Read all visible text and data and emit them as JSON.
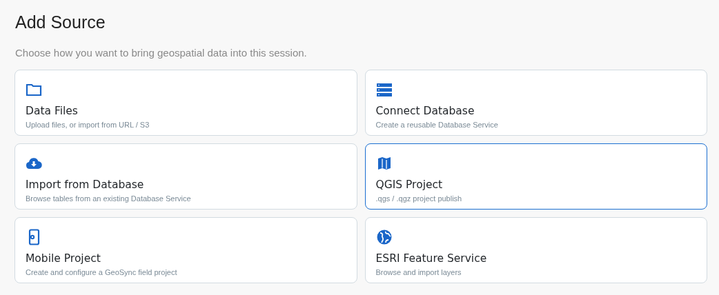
{
  "title": "Add Source",
  "subtitle": "Choose how you want to bring geospatial data into this session.",
  "sources": [
    {
      "kind": "folder",
      "title": "Data Files",
      "description": "Upload files, or import from URL / S3",
      "highlighted": false
    },
    {
      "kind": "server",
      "title": "Connect Database",
      "description": "Create a reusable Database Service",
      "highlighted": false
    },
    {
      "kind": "cloud",
      "title": "Import from Database",
      "description": "Browse tables from an existing Database Service",
      "highlighted": false
    },
    {
      "kind": "map",
      "title": "QGIS Project",
      "description": ".qgs / .qgz project publish",
      "highlighted": true
    },
    {
      "kind": "mobile",
      "title": "Mobile Project",
      "description": "Create and configure a GeoSync field project",
      "highlighted": false
    },
    {
      "kind": "globe",
      "title": "ESRI Feature Service",
      "description": "Browse and import layers",
      "highlighted": false
    }
  ]
}
